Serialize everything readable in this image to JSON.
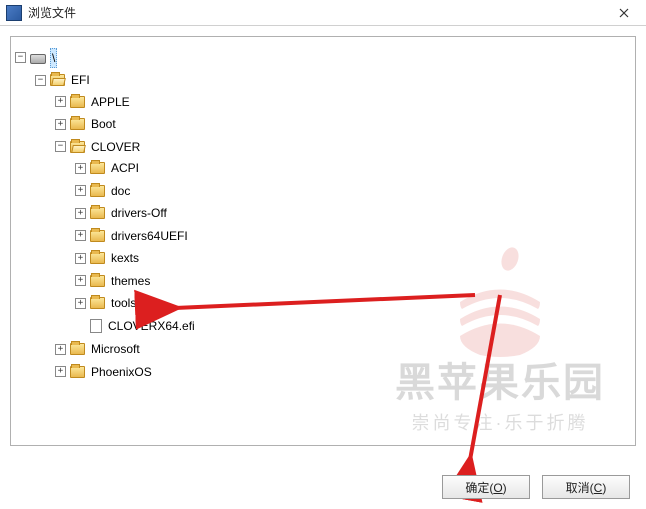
{
  "window": {
    "title": "浏览文件"
  },
  "tree": {
    "root": {
      "label": "\\"
    },
    "efi": {
      "label": "EFI"
    },
    "apple": {
      "label": "APPLE"
    },
    "boot": {
      "label": "Boot"
    },
    "clover": {
      "label": "CLOVER"
    },
    "acpi": {
      "label": "ACPI"
    },
    "doc": {
      "label": "doc"
    },
    "driversOff": {
      "label": "drivers-Off"
    },
    "drivers64": {
      "label": "drivers64UEFI"
    },
    "kexts": {
      "label": "kexts"
    },
    "themes": {
      "label": "themes"
    },
    "tools": {
      "label": "tools"
    },
    "cloverx64": {
      "label": "CLOVERX64.efi"
    },
    "microsoft": {
      "label": "Microsoft"
    },
    "phoenix": {
      "label": "PhoenixOS"
    }
  },
  "buttons": {
    "ok": {
      "label_pre": "确定(",
      "hotkey": "O",
      "label_post": ")"
    },
    "cancel": {
      "label_pre": "取消(",
      "hotkey": "C",
      "label_post": ")"
    }
  },
  "watermark": {
    "line1": "黑苹果乐园",
    "line2": "崇尚专注·乐于折腾"
  }
}
